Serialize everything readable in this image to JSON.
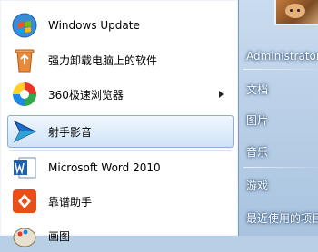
{
  "programs": [
    {
      "label": "Windows Update",
      "icon": "windows-update-icon",
      "has_submenu": false,
      "selected": false
    },
    {
      "label": "强力卸载电脑上的软件",
      "icon": "uninstall-recycle-icon",
      "has_submenu": false,
      "selected": false
    },
    {
      "label": "360极速浏览器",
      "icon": "360-browser-icon",
      "has_submenu": true,
      "selected": false
    },
    {
      "label": "射手影音",
      "icon": "shooter-player-icon",
      "has_submenu": false,
      "selected": true
    },
    {
      "label": "Microsoft Word 2010",
      "icon": "word-icon",
      "has_submenu": false,
      "selected": false
    },
    {
      "label": "靠谱助手",
      "icon": "kaopu-assistant-icon",
      "has_submenu": false,
      "selected": false
    },
    {
      "label": "画图",
      "icon": "paint-icon",
      "has_submenu": false,
      "selected": false
    }
  ],
  "right_menu": {
    "user": "Administrator",
    "items": [
      "文档",
      "图片",
      "音乐",
      "游戏",
      "最近使用的项目"
    ]
  },
  "colors": {
    "selection": "#cfe3f7",
    "right_pane": "#a9c3df"
  }
}
